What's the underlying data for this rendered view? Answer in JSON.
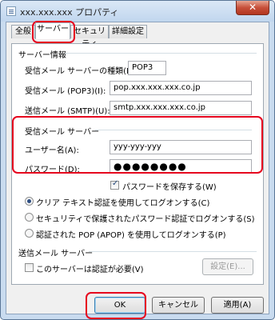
{
  "window": {
    "title": "xxx.xxx.xxx プロパティ",
    "close_label": "✕"
  },
  "tabs": [
    "全般",
    "サーバー",
    "セキュリティ",
    "詳細設定"
  ],
  "server_info": {
    "heading": "サーバー情報",
    "type_label": "受信メール サーバーの種類(M)",
    "type_value": "POP3",
    "incoming_label": "受信メール (POP3)(I):",
    "incoming_value": "pop.xxx.xxx.xxx.co.jp",
    "outgoing_label": "送信メール (SMTP)(U):",
    "outgoing_value": "smtp.xxx.xxx.xxx.co.jp"
  },
  "incoming_server": {
    "heading": "受信メール サーバー",
    "username_label": "ユーザー名(A):",
    "username_value": "yyy-yyy-yyy",
    "password_label": "パスワード(D):",
    "password_value": "●●●●●●●●",
    "save_password_label": "パスワードを保存する(W)",
    "save_password_checked": true,
    "auth_options": [
      {
        "label": "クリア テキスト認証を使用してログオンする(C)",
        "checked": true
      },
      {
        "label": "セキュリティで保護されたパスワード認証でログオンする(S)",
        "checked": false
      },
      {
        "label": "認証された POP (APOP) を使用してログオンする(P)",
        "checked": false
      }
    ]
  },
  "outgoing_server": {
    "heading": "送信メール サーバー",
    "auth_required_label": "このサーバーは認証が必要(V)",
    "auth_required_checked": false,
    "settings_button": "設定(E)..."
  },
  "buttons": {
    "ok": "OK",
    "cancel": "キャンセル",
    "apply": "適用(A)"
  },
  "highlight_color": "#e6001e"
}
